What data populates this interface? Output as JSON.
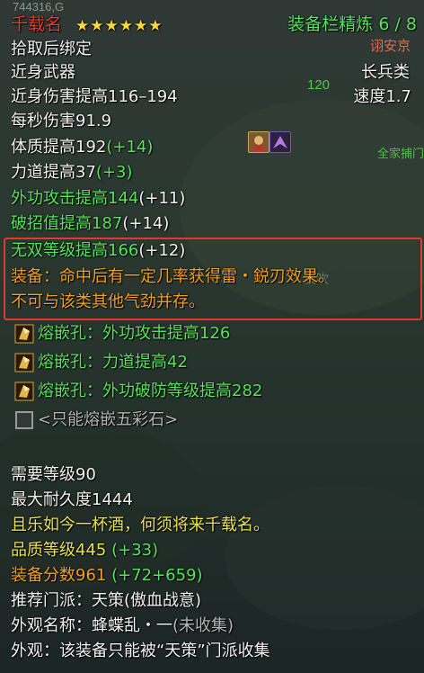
{
  "header": {
    "item_name": "千载名",
    "stars": "★★★★★★",
    "refine_label": "装备栏精炼 6 / 8",
    "bind": "拾取后绑定"
  },
  "weapon": {
    "type_left": "近身武器",
    "type_right": "长兵类",
    "damage": "近身伤害提高116–194",
    "speed": "速度1.7",
    "dps": "每秒伤害91.9"
  },
  "attributes": [
    {
      "text": "体质提高192",
      "bonus": "(+14)"
    },
    {
      "text": "力道提高37",
      "bonus": "(+3)"
    },
    {
      "text": "外功攻击提高144",
      "bonus": "(+11)"
    },
    {
      "text": "破招值提高187",
      "bonus": "(+14)"
    },
    {
      "text": "无双等级提高166",
      "bonus": "(+12)"
    }
  ],
  "effect": {
    "line1": "装备：命中后有一定几率获得雷・鋭刃效果。",
    "line2": "不可与该类其他气劲并存。"
  },
  "sockets": [
    {
      "text": "熔嵌孔：外功攻击提高126"
    },
    {
      "text": "熔嵌孔：力道提高42"
    },
    {
      "text": "熔嵌孔：外功破防等级提高282"
    }
  ],
  "empty_socket": "<只能熔嵌五彩石>",
  "requirements": {
    "level": "需要等级90",
    "durability": "最大耐久度1444"
  },
  "flavor": "且乐如今一杯酒，何须将来千载名。",
  "quality": {
    "text": "品质等级445",
    "bonus": "(+33)"
  },
  "score": {
    "text": "装备分数961",
    "bonus": "(+72+659)"
  },
  "school": "推荐门派：天策(傲血战意)",
  "appearance_name": {
    "text": "外观名称：蜂蝶乱・一",
    "status": "(未收集)"
  },
  "appearance_note": "外观：该装备只能被“天策”门派收集",
  "background_text": {
    "id": "744316,G",
    "t1": "诩安京",
    "t2": "120",
    "t3": "全家捕门",
    "t4": "鼓吹"
  },
  "colors": {
    "name": "#e93b2f",
    "white": "#f1f1ef",
    "green": "#56e45a",
    "orange": "#f4a01e",
    "yellow": "#e8e24e",
    "highlight_border": "#e0392f"
  },
  "icons": [
    "socket-gem-icon",
    "empty-socket-icon",
    "buff-portrait-icon",
    "buff-wings-icon"
  ]
}
